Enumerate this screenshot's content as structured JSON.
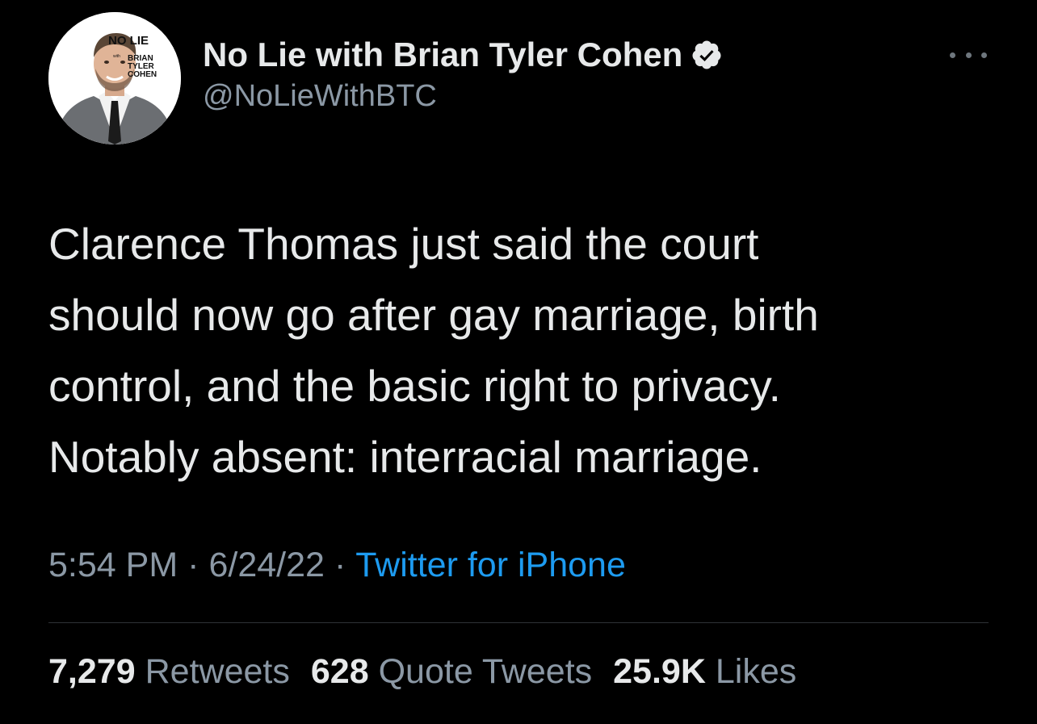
{
  "author": {
    "display_name": "No Lie with Brian Tyler Cohen",
    "handle": "@NoLieWithBTC",
    "verified_icon": "verified-badge-icon",
    "avatar_logo_text": "NO LIE with BRIAN TYLER COHEN"
  },
  "tweet": {
    "text": "Clarence Thomas just said the court\nshould now go after gay marriage, birth\ncontrol, and the basic right to privacy.\nNotably absent: interracial marriage."
  },
  "meta": {
    "time": "5:54 PM",
    "date": "6/24/22",
    "separator": "·",
    "source": "Twitter for iPhone"
  },
  "stats": {
    "retweets_count": "7,279",
    "retweets_label": "Retweets",
    "quotes_count": "628",
    "quotes_label": "Quote Tweets",
    "likes_count": "25.9K",
    "likes_label": "Likes"
  },
  "colors": {
    "background": "#000000",
    "primary_text": "#e7e9ea",
    "secondary_text": "#8b98a5",
    "link": "#1d9bf0",
    "divider": "#2f3336"
  },
  "icons": {
    "more": "more-options-icon"
  }
}
